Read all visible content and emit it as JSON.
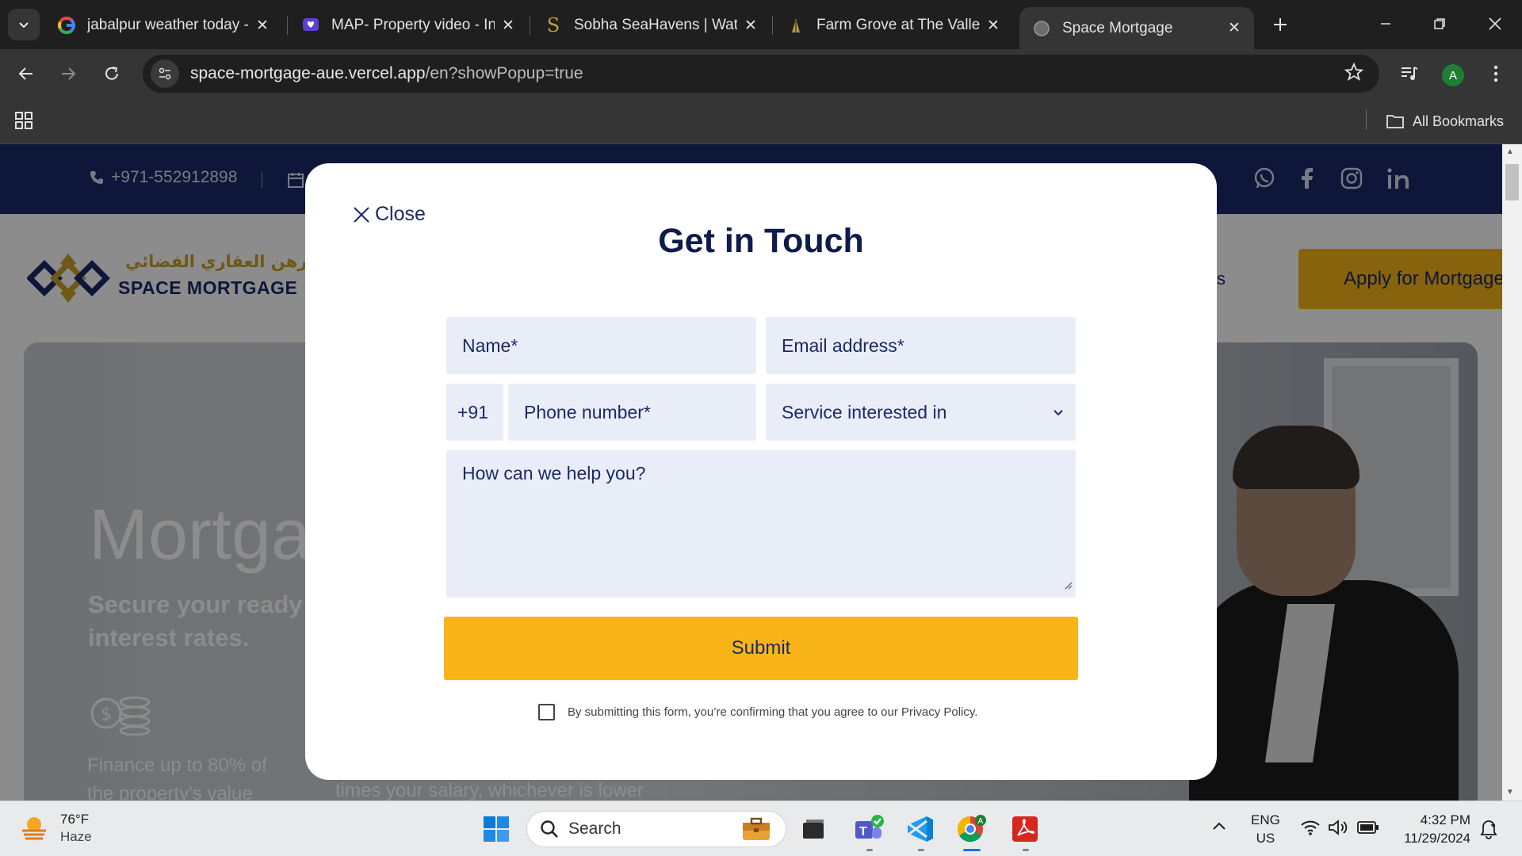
{
  "browser": {
    "tabs": [
      {
        "title": "jabalpur weather today -",
        "favicon": "google-icon"
      },
      {
        "title": "MAP- Property video - In",
        "favicon": "heart-chat-icon"
      },
      {
        "title": "Sobha SeaHavens | Water",
        "favicon": "sobha-s-icon"
      },
      {
        "title": "Farm Grove at The Valley",
        "favicon": "farm-grove-icon"
      },
      {
        "title": "Space Mortgage",
        "favicon": "globe-icon",
        "active": true
      }
    ],
    "url_host": "space-mortgage-aue.vercel.app",
    "url_path": "/en?showPopup=true",
    "avatar_letter": "A",
    "all_bookmarks": "All Bookmarks"
  },
  "site": {
    "phone": "+971-552912898",
    "logo_arabic": "الرهن العقاري الفضائي",
    "logo_name": "SPACE MORTGAGE",
    "nav_partial": "s",
    "apply_button": "Apply for Mortgage",
    "hero_title": "Mortgage",
    "hero_subtitle": "Secure your ready interest rates.",
    "hero_feature_1": "Finance up to 80% of the property's value",
    "hero_feature_2": "times your salary, whichever is lower"
  },
  "modal": {
    "close_label": "Close",
    "title": "Get in Touch",
    "name_placeholder": "Name*",
    "email_placeholder": "Email address*",
    "country_code": "+91",
    "phone_placeholder": "Phone number*",
    "service_placeholder": "Service interested in",
    "message_placeholder": "How can we help you?",
    "submit_label": "Submit",
    "consent_text": "By submitting this form, you’re confirming that you agree to our Privacy Policy.",
    "consent_checked": false
  },
  "taskbar": {
    "temperature": "76°F",
    "condition": "Haze",
    "search_label": "Search",
    "lang_1": "ENG",
    "lang_2": "US",
    "time": "4:32 PM",
    "date": "11/29/2024"
  },
  "colors": {
    "navy": "#1a2a68",
    "gold": "#f9b418",
    "field_bg": "#e9edf7"
  }
}
